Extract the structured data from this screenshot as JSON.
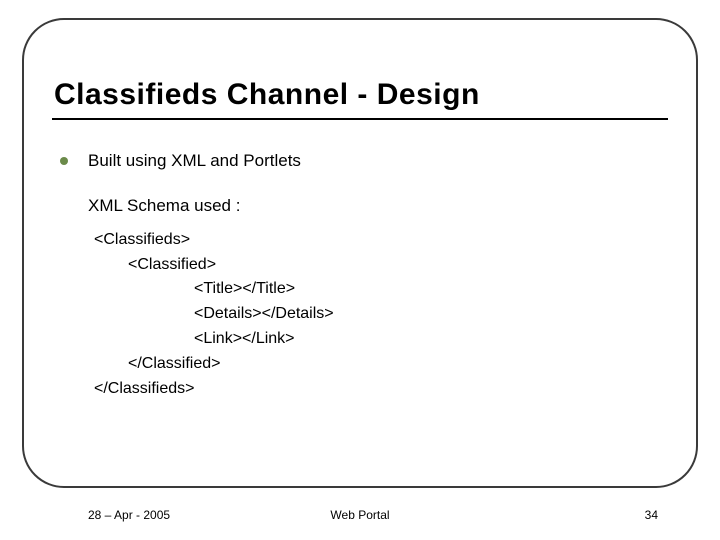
{
  "title": "Classifieds Channel - Design",
  "bullet1": "Built using XML and Portlets",
  "subhead": "XML Schema used :",
  "code": {
    "l1": "<Classifieds>",
    "l2": "<Classified>",
    "l3": "<Title></Title>",
    "l4": "<Details></Details>",
    "l5": "<Link></Link>",
    "l6": "</Classified>",
    "l7": "</Classifieds>"
  },
  "footer": {
    "left": "28 – Apr - 2005",
    "center": "Web Portal",
    "right": "34"
  }
}
